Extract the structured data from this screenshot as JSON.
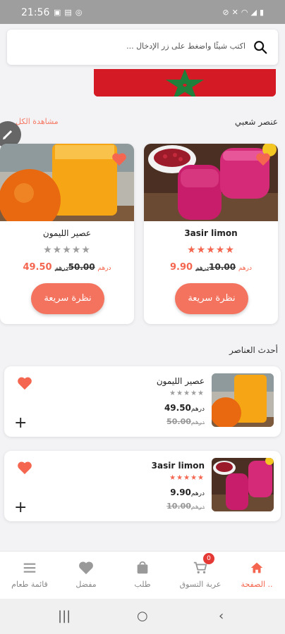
{
  "status_bar": {
    "time": "21:56",
    "icons": [
      "gallery-icon",
      "screenshot-icon",
      "shazam-icon"
    ],
    "system_icons": [
      "mute-icon",
      "no-sound-icon",
      "wifi-icon",
      "signal-icon",
      "battery-icon"
    ]
  },
  "search": {
    "placeholder": "اكتب شيئًا واضغط على زر الإدخال ..."
  },
  "banner": {
    "description_icon": "morocco-flag-banner",
    "colors": {
      "red": "#d31a25",
      "green": "#1f7f3b"
    }
  },
  "popular_section": {
    "title": "عنصر شعبي",
    "see_all": "مشاهدة الكل"
  },
  "popular_products": [
    {
      "name": "3asir limon",
      "stars": 5,
      "price_new": "9.90",
      "price_old": "10.00",
      "currency": "درهم",
      "quick_view": "نظرة سريعة",
      "favorite": true,
      "image": "pomegranate-juice"
    },
    {
      "name": "عصير الليمون",
      "stars": 0,
      "price_new": "49.50",
      "price_old": "50.00",
      "currency": "درهم",
      "quick_view": "نظرة سريعة",
      "favorite": true,
      "image": "orange-juice"
    }
  ],
  "latest_section": {
    "title": "أحدث العناصر"
  },
  "latest_items": [
    {
      "name": "عصير الليمون",
      "stars": 0,
      "price_new": "49.50",
      "price_old": "50.00",
      "currency": "درهم",
      "image": "orange-juice"
    },
    {
      "name": "3asir limon",
      "stars": 5,
      "price_new": "9.90",
      "price_old": "10.00",
      "currency": "درهم",
      "image": "pomegranate-juice"
    }
  ],
  "bottom_nav": [
    {
      "label": "الصفحة ..",
      "icon": "home-icon",
      "active": true
    },
    {
      "label": "عربة التسوق",
      "icon": "cart-icon",
      "badge": "0"
    },
    {
      "label": "طلب",
      "icon": "bag-icon"
    },
    {
      "label": "مفضل",
      "icon": "heart-icon"
    },
    {
      "label": "قائمة طعام",
      "icon": "menu-icon"
    }
  ],
  "theme": {
    "accent": "#f4664f",
    "button": "#f4735e",
    "star_on": "#f4664f",
    "star_off": "#9e9e9e"
  }
}
